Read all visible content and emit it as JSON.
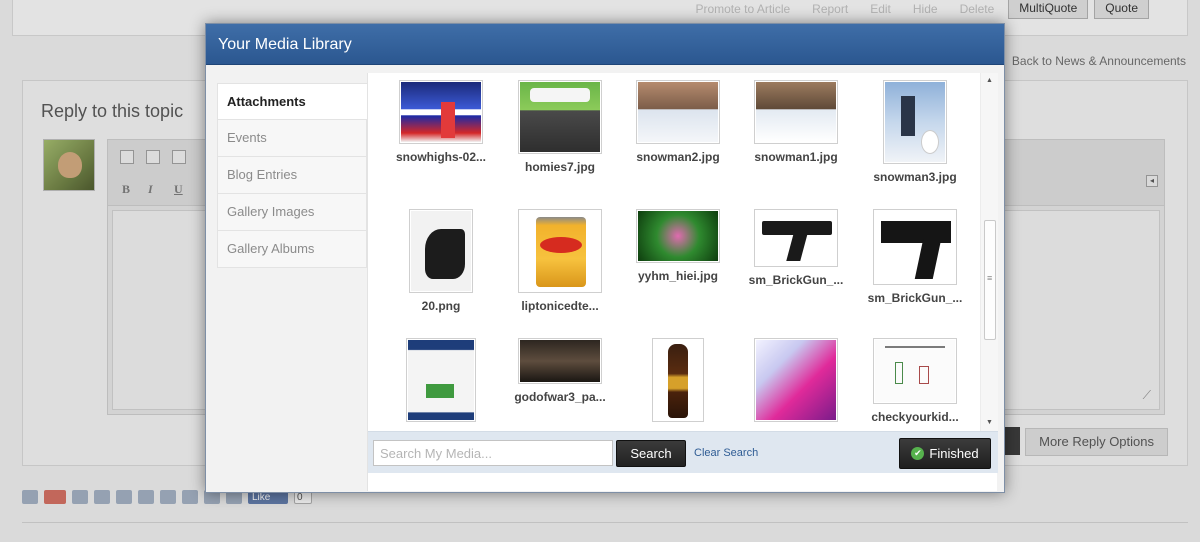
{
  "background": {
    "post_actions": [
      "Promote to Article",
      "Report",
      "Edit",
      "Hide",
      "Delete"
    ],
    "multiquote_label": "MultiQuote",
    "quote_label": "Quote",
    "back_link": "Back to News & Announcements",
    "reply_title": "Reply to this topic",
    "more_reply_options_label": "More Reply Options",
    "facebook_like_label": "Like",
    "like_count": "0"
  },
  "modal": {
    "title": "Your Media Library",
    "tabs": [
      {
        "label": "Attachments",
        "active": true
      },
      {
        "label": "Events",
        "active": false
      },
      {
        "label": "Blog Entries",
        "active": false
      },
      {
        "label": "Gallery Images",
        "active": false
      },
      {
        "label": "Gallery Albums",
        "active": false
      }
    ],
    "media": [
      {
        "name": "snowhighs-02...",
        "thumb": "snowhighs"
      },
      {
        "name": "homies7.jpg",
        "thumb": "homies"
      },
      {
        "name": "snowman2.jpg",
        "thumb": "snow-field"
      },
      {
        "name": "snowman1.jpg",
        "thumb": "snow-trees"
      },
      {
        "name": "snowman3.jpg",
        "thumb": "snowman-person"
      },
      {
        "name": "20.png",
        "thumb": "manga"
      },
      {
        "name": "liptonicedte...",
        "thumb": "lipton-can"
      },
      {
        "name": "yyhm_hiei.jpg",
        "thumb": "green-glow"
      },
      {
        "name": "sm_BrickGun_...",
        "thumb": "gun-1"
      },
      {
        "name": "sm_BrickGun_...",
        "thumb": "gun-2"
      },
      {
        "name": "",
        "thumb": "webpage"
      },
      {
        "name": "godofwar3_pa...",
        "thumb": "godofwar"
      },
      {
        "name": "",
        "thumb": "bottle"
      },
      {
        "name": "",
        "thumb": "pink-poster"
      },
      {
        "name": "checkyourkid...",
        "thumb": "sketch"
      }
    ],
    "search": {
      "placeholder": "Search My Media...",
      "button_label": "Search",
      "clear_label": "Clear Search"
    },
    "finished_label": "Finished"
  },
  "colors": {
    "header_blue": "#3f6ea8",
    "link_blue": "#2f5c94",
    "finished_check": "#56b24d"
  }
}
